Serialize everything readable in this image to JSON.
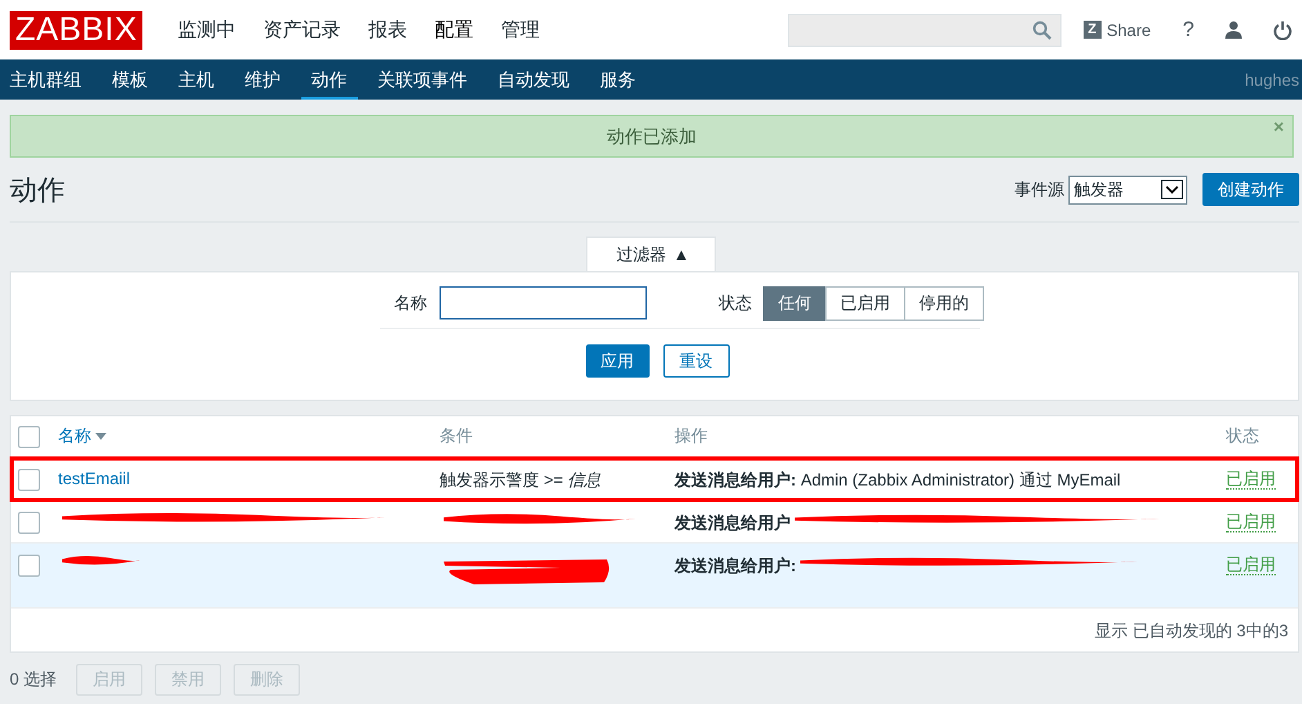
{
  "header": {
    "logo": "ZABBIX",
    "menu": [
      {
        "label": "监测中",
        "selected": false
      },
      {
        "label": "资产记录",
        "selected": false
      },
      {
        "label": "报表",
        "selected": false
      },
      {
        "label": "配置",
        "selected": true
      },
      {
        "label": "管理",
        "selected": false
      }
    ],
    "share_badge": "Z",
    "share": "Share",
    "help": "?"
  },
  "subnav": {
    "items": [
      {
        "label": "主机群组",
        "selected": false
      },
      {
        "label": "模板",
        "selected": false
      },
      {
        "label": "主机",
        "selected": false
      },
      {
        "label": "维护",
        "selected": false
      },
      {
        "label": "动作",
        "selected": true
      },
      {
        "label": "关联项事件",
        "selected": false
      },
      {
        "label": "自动发现",
        "selected": false
      },
      {
        "label": "服务",
        "selected": false
      }
    ],
    "user": "hughes"
  },
  "message": {
    "text": "动作已添加",
    "close": "×"
  },
  "page": {
    "title": "动作",
    "event_source_label": "事件源",
    "event_source": "触发器",
    "create_button": "创建动作"
  },
  "filter": {
    "toggle": "过滤器",
    "toggle_arrow": "▲",
    "expanded": true,
    "name_label": "名称",
    "status_label": "状态",
    "status_options": [
      {
        "label": "任何",
        "selected": true
      },
      {
        "label": "已启用",
        "selected": false
      },
      {
        "label": "停用的",
        "selected": false
      }
    ],
    "apply": "应用",
    "reset": "重设"
  },
  "table": {
    "all_checked": false,
    "columns": [
      {
        "label": "名称",
        "sorted": true
      },
      {
        "label": "条件",
        "sorted": false
      },
      {
        "label": "操作",
        "sorted": false
      },
      {
        "label": "状态",
        "sorted": false
      }
    ],
    "rows": [
      {
        "name": "testEmaiil",
        "condition": "触发器示警度 >= *信息*",
        "operation": "**发送消息给用户:** Admin (Zabbix Administrator) 通过 MyEmail",
        "status": "已启用",
        "checked": false,
        "highlighted": true,
        "hovered": false,
        "redacted": false
      },
      {
        "operation": "**发送消息给用户**",
        "status": "已启用",
        "checked": false,
        "highlighted": false,
        "hovered": false,
        "redacted": true
      },
      {
        "operation": "**发送消息给用户:**",
        "status": "已启用",
        "checked": false,
        "highlighted": false,
        "hovered": true,
        "redacted": true
      }
    ],
    "footer": "显示 已自动发现的 3中的3"
  },
  "selection": {
    "count": "0 选择",
    "buttons": [
      {
        "label": "启用",
        "disabled": true
      },
      {
        "label": "禁用",
        "disabled": true
      },
      {
        "label": "删除",
        "disabled": true
      }
    ]
  }
}
